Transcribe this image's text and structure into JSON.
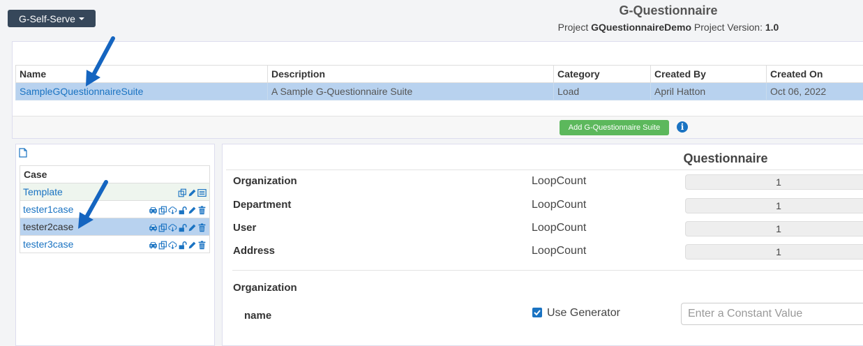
{
  "header": {
    "menu_label": "G-Self-Serve",
    "app_title": "G-Questionnaire",
    "project_prefix": "Project",
    "project_name": "GQuestionnaireDemo",
    "version_prefix": "Project Version:",
    "version": "1.0"
  },
  "suites": {
    "columns": [
      "Name",
      "Description",
      "Category",
      "Created By",
      "Created On"
    ],
    "rows": [
      {
        "name": "SampleGQuestionnaireSuite",
        "description": "A Sample G-Questionnaire Suite",
        "category": "Load",
        "created_by": "April Hatton",
        "created_on": "Oct 06, 2022"
      }
    ],
    "add_button": "Add G-Questionnaire Suite"
  },
  "cases": {
    "header": "Case",
    "rows": [
      {
        "name": "Template"
      },
      {
        "name": "tester1case"
      },
      {
        "name": "tester2case"
      },
      {
        "name": "tester3case"
      }
    ]
  },
  "questionnaire": {
    "title": "Questionnaire",
    "rows": [
      {
        "label": "Organization",
        "loop_label": "LoopCount",
        "value": "1"
      },
      {
        "label": "Department",
        "loop_label": "LoopCount",
        "value": "1"
      },
      {
        "label": "User",
        "loop_label": "LoopCount",
        "value": "1"
      },
      {
        "label": "Address",
        "loop_label": "LoopCount",
        "value": "1"
      }
    ],
    "section_heading": "Organization",
    "field_label": "name",
    "use_generator_label": "Use Generator",
    "constant_placeholder": "Enter a Constant Value"
  },
  "colors": {
    "accent": "#1a73c2",
    "selected_row": "#b8d2ef",
    "add_button": "#5cb85c",
    "arrow": "#1565c0"
  }
}
